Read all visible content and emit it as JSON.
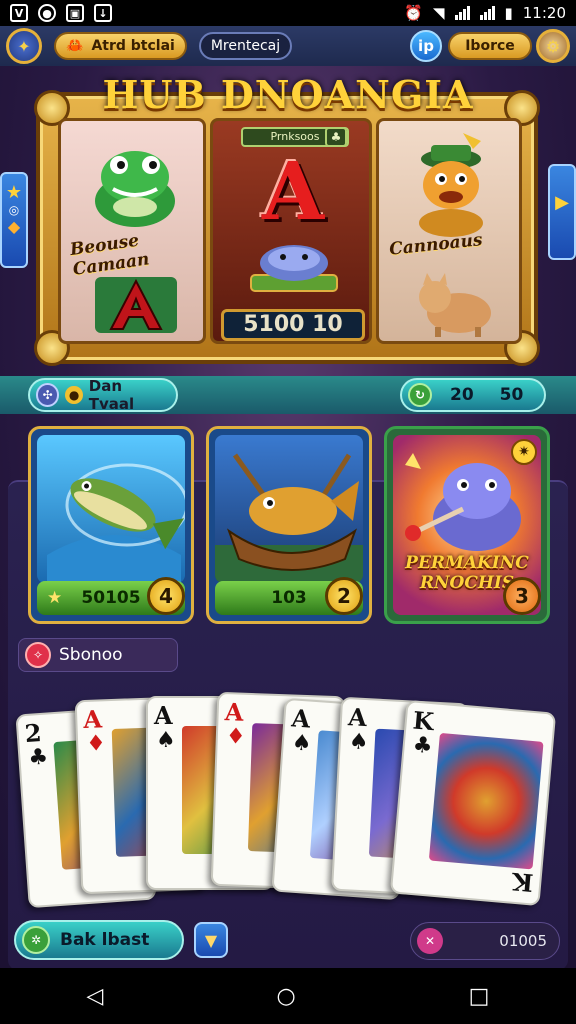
{
  "status_bar": {
    "time": "11:20",
    "left_icons": [
      "app-v-icon",
      "messenger-icon",
      "gallery-icon",
      "download-icon"
    ],
    "right_icons": [
      "alarm-icon",
      "wifi-icon",
      "signal-icon",
      "battery-icon"
    ]
  },
  "hud": {
    "player_pill": "Atrd btclai",
    "message_pill": "Mrentecaj",
    "info_button": "ip",
    "coin_pill": "Iborce"
  },
  "slot": {
    "title": "HUB DNOANGIA",
    "reel1_label": "Beouse Camaan",
    "reel2_header": "Prnksoos",
    "reel2_symbol": "A",
    "reel2_counter": "5100 10",
    "reel3_label": "Cannoaus"
  },
  "info_row": {
    "left_label": "Dan Tvaal",
    "right_value_1": "20",
    "right_value_2": "50"
  },
  "cards": [
    {
      "value": "50105",
      "badge": "4"
    },
    {
      "value": "103",
      "badge": "2"
    },
    {
      "caption": "PERMAKINC RNOCHIS",
      "badge": "3"
    }
  ],
  "section_tag": "Sbonoo",
  "hand": [
    {
      "rank": "2",
      "suit": "♣",
      "color": "black"
    },
    {
      "rank": "A",
      "suit": "♦",
      "color": "red"
    },
    {
      "rank": "A",
      "suit": "♠",
      "color": "black"
    },
    {
      "rank": "A",
      "suit": "♦",
      "color": "red"
    },
    {
      "rank": "A",
      "suit": "♠",
      "color": "black"
    },
    {
      "rank": "A",
      "suit": "♠",
      "color": "black"
    },
    {
      "rank": "K",
      "suit": "♣",
      "color": "black"
    }
  ],
  "bottom_bar": {
    "left_label": "Bak lbast",
    "right_value": "01005"
  },
  "nav": {
    "back": "◁",
    "home": "○",
    "recents": "□"
  }
}
